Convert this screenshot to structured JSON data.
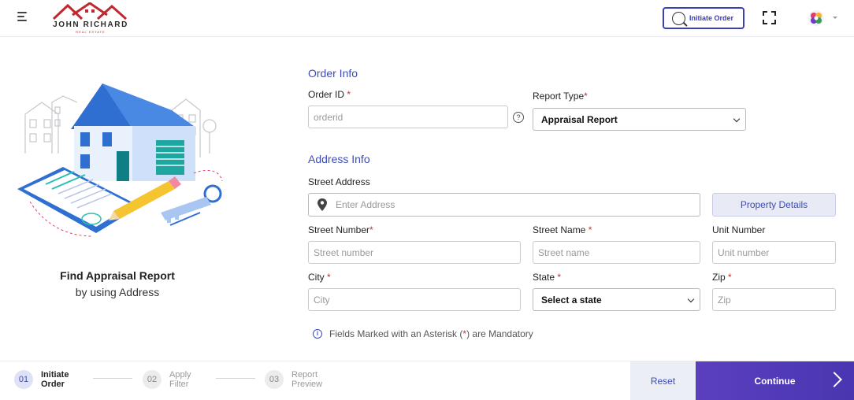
{
  "header": {
    "logo_name": "JOHN RICHARD",
    "logo_sub": "REAL ESTATE",
    "initiate_order_label": "Initiate Order"
  },
  "left_panel": {
    "title": "Find Appraisal Report",
    "subtitle": "by using Address"
  },
  "order_info": {
    "section_title": "Order Info",
    "order_id_label": "Order ID",
    "order_id_placeholder": "orderid",
    "report_type_label": "Report Type",
    "report_type_value": "Appraisal Report"
  },
  "address_info": {
    "section_title": "Address Info",
    "street_address_label": "Street Address",
    "street_address_placeholder": "Enter Address",
    "property_details_label": "Property Details",
    "street_number_label": "Street Number",
    "street_number_placeholder": "Street number",
    "street_name_label": "Street Name",
    "street_name_placeholder": "Street name",
    "unit_number_label": "Unit Number",
    "unit_number_placeholder": "Unit number",
    "city_label": "City",
    "city_placeholder": "City",
    "state_label": "State",
    "state_value": "Select a state",
    "zip_label": "Zip",
    "zip_placeholder": "Zip"
  },
  "required_mark": "*",
  "mandatory_note": {
    "prefix": "Fields Marked with an Asterisk (",
    "star": " * ",
    "suffix": ") are Mandatory"
  },
  "footer": {
    "steps": [
      {
        "num": "01",
        "line1": "Initiate",
        "line2": "Order",
        "active": true
      },
      {
        "num": "02",
        "line1": "Apply",
        "line2": "Filter",
        "active": false
      },
      {
        "num": "03",
        "line1": "Report",
        "line2": "Preview",
        "active": false
      }
    ],
    "reset_label": "Reset",
    "continue_label": "Continue"
  },
  "colors": {
    "accent": "#3b4cb8",
    "primary_button": "#5b3fbf",
    "required": "#d62c2c",
    "logo_red": "#c0282e"
  },
  "icons": {
    "menu": "hamburger-icon",
    "search": "search-icon",
    "fullscreen": "fullscreen-icon",
    "help": "help-icon",
    "location": "location-pin-icon",
    "info": "info-icon",
    "continue": "chevron-right-icon"
  }
}
